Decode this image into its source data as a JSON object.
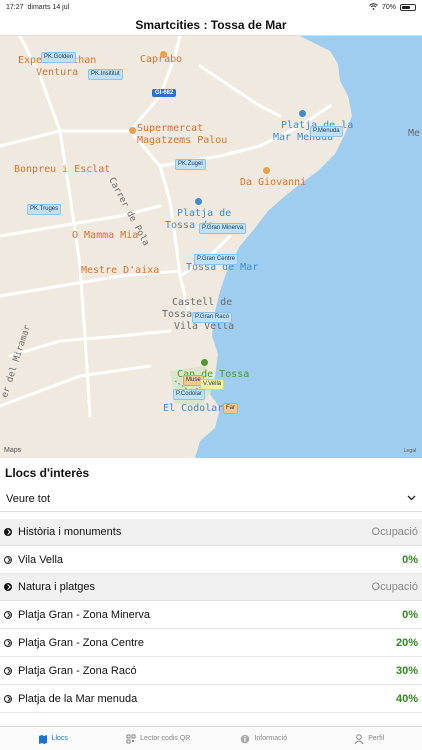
{
  "status": {
    "time": "17:27",
    "date": "dimarts 14 jul",
    "battery": "70%",
    "battery_level": 0.7
  },
  "nav": {
    "title": "Smartcities : Tossa de Mar"
  },
  "map": {
    "labels": {
      "expert": "Experts Ochan",
      "ventura": "Ventura",
      "caprabo": "Caprabo",
      "supermercat": "Supermercat",
      "magatzems": "Magatzems Palou",
      "bonpreu": "Bonpreu i Esclat",
      "carrer_pola": "Carrer de Pola",
      "platja_mar_menuda_1": "Platja de la",
      "platja_mar_menuda_2": "Mar Menuda",
      "da_giovanni": "Da Giovanni",
      "mamma_mia": "O Mamma Mia",
      "platja_tossa_1": "Platja de",
      "platja_tossa_2": "Tossa de",
      "gran_tossa": "Tossa de Mar",
      "mestre_aixa": "Mestre D'aixa",
      "castell_1": "Castell de",
      "castell_2": "Tossa",
      "vila_vella": "Vila Vella",
      "cap_tossa": "Cap de Tossa",
      "el_codolar": "El Codolar",
      "miramar": "er del Miramar",
      "me": "Me"
    },
    "parkings": {
      "golden": "PK.Golden",
      "insititut": "PK.Insititut",
      "zugel": "PK.Zugel",
      "truges": "PK.Truges",
      "menuda": "P.Menuda",
      "gran_minerva": "P.Gran Minerva",
      "gran_centre": "P.Gran Centre",
      "gran_raco": "P.Gran Racó",
      "muse": "Muse",
      "vvella": "V.Vella",
      "codolar": "P.Codolar",
      "far": "Far"
    },
    "road_badge": "GI-682",
    "maps_logo": "Maps",
    "legal": "Legal"
  },
  "section": {
    "title": "Llocs d'interès"
  },
  "filter": {
    "value": "Veure tot"
  },
  "categories": [
    {
      "title": "Història i monuments",
      "column": "Ocupació",
      "items": [
        {
          "name": "Vila Vella",
          "occupancy": "0%"
        }
      ]
    },
    {
      "title": "Natura i platges",
      "column": "Ocupació",
      "items": [
        {
          "name": "Platja Gran - Zona Minerva",
          "occupancy": "0%"
        },
        {
          "name": "Platja Gran - Zona Centre",
          "occupancy": "20%"
        },
        {
          "name": "Platja Gran - Zona Racó",
          "occupancy": "30%"
        },
        {
          "name": "Platja de la Mar menuda",
          "occupancy": "40%"
        }
      ]
    }
  ],
  "tabs": [
    {
      "label": "Llocs",
      "icon": "map-icon"
    },
    {
      "label": "Lector codis QR",
      "icon": "qr-icon"
    },
    {
      "label": "Informació",
      "icon": "info-icon"
    },
    {
      "label": "Perfil",
      "icon": "person-icon"
    }
  ],
  "colors": {
    "accent": "#1a73d9",
    "occupancy_green": "#2e8b1c",
    "sea": "#9fcdf0",
    "land": "#efe9df"
  }
}
